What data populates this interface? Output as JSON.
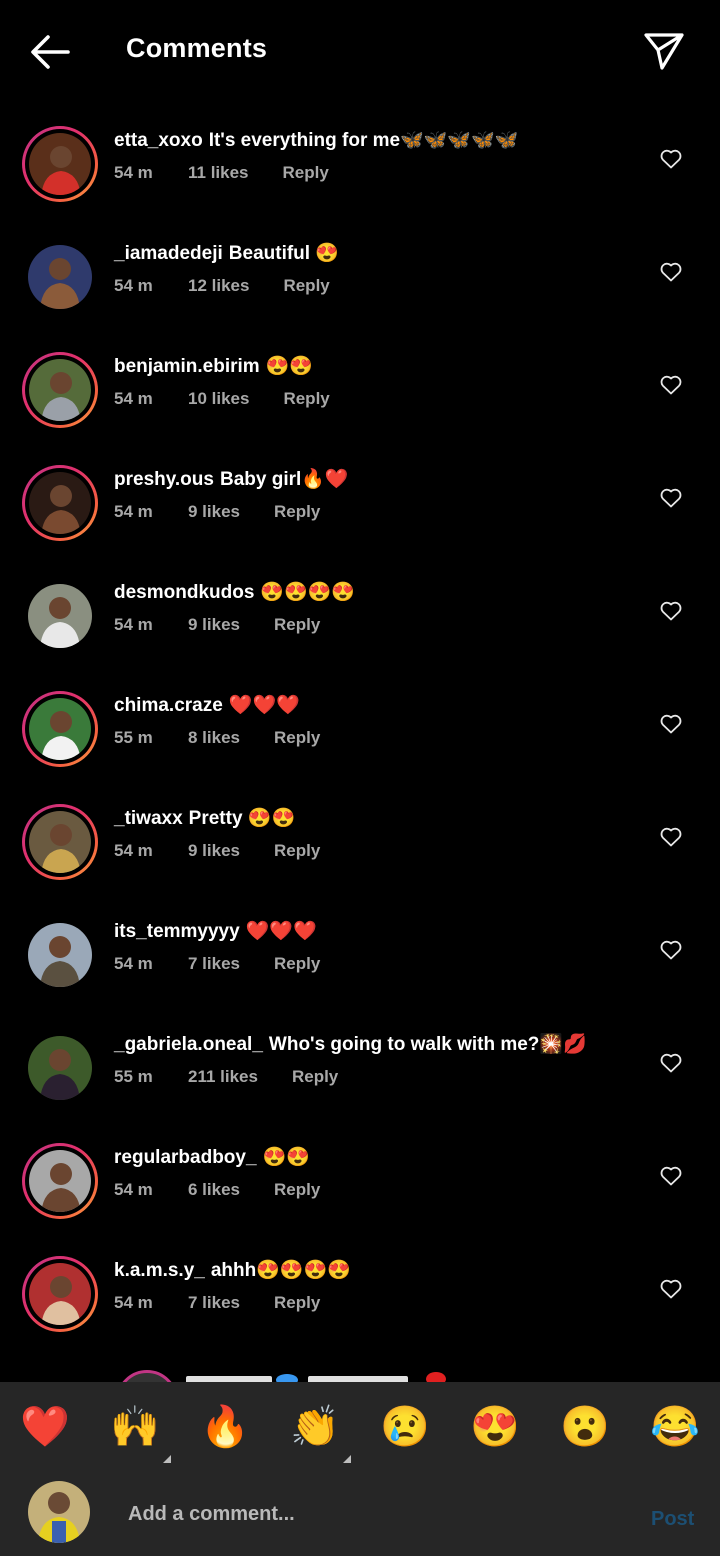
{
  "header": {
    "title": "Comments",
    "back_icon": "arrow-left-icon",
    "send_icon": "send-icon"
  },
  "comments": [
    {
      "username": "etta_xoxo",
      "text": "It's everything for me🦋🦋🦋🦋🦋",
      "time": "54 m",
      "likes": "11 likes",
      "reply": "Reply",
      "story_ring": true,
      "avatar_bg": "#5a2f1a",
      "avatar_fg": "#d3302a"
    },
    {
      "username": "_iamadedeji",
      "text": "Beautiful 😍",
      "time": "54 m",
      "likes": "12 likes",
      "reply": "Reply",
      "story_ring": false,
      "avatar_bg": "#2f3a6c",
      "avatar_fg": "#8b5b3a"
    },
    {
      "username": "benjamin.ebirim",
      "text": "😍😍",
      "time": "54 m",
      "likes": "10 likes",
      "reply": "Reply",
      "story_ring": true,
      "avatar_bg": "#556b3a",
      "avatar_fg": "#9aa0a8"
    },
    {
      "username": "preshy.ous",
      "text": "Baby girl🔥❤️",
      "time": "54 m",
      "likes": "9 likes",
      "reply": "Reply",
      "story_ring": true,
      "avatar_bg": "#2a1a14",
      "avatar_fg": "#7a4a30"
    },
    {
      "username": "desmondkudos",
      "text": "😍😍😍😍",
      "time": "54 m",
      "likes": "9 likes",
      "reply": "Reply",
      "story_ring": false,
      "avatar_bg": "#8a8f80",
      "avatar_fg": "#e8e8e8"
    },
    {
      "username": "chima.craze",
      "text": "❤️❤️❤️",
      "time": "55 m",
      "likes": "8 likes",
      "reply": "Reply",
      "story_ring": true,
      "avatar_bg": "#3a7a3a",
      "avatar_fg": "#f2f2f2"
    },
    {
      "username": "_tiwaxx",
      "text": "Pretty 😍😍",
      "time": "54 m",
      "likes": "9 likes",
      "reply": "Reply",
      "story_ring": true,
      "avatar_bg": "#6a5a40",
      "avatar_fg": "#c9a550"
    },
    {
      "username": "its_temmyyyy",
      "text": "❤️❤️❤️",
      "time": "54 m",
      "likes": "7 likes",
      "reply": "Reply",
      "story_ring": false,
      "avatar_bg": "#9aa8b8",
      "avatar_fg": "#5a5040"
    },
    {
      "username": "_gabriela.oneal_",
      "text": "Who's going to walk with me?🎇💋",
      "time": "55 m",
      "likes": "211 likes",
      "reply": "Reply",
      "story_ring": false,
      "avatar_bg": "#3d5a2a",
      "avatar_fg": "#2a2030"
    },
    {
      "username": "regularbadboy_",
      "text": "😍😍",
      "time": "54 m",
      "likes": "6 likes",
      "reply": "Reply",
      "story_ring": true,
      "avatar_bg": "#a8a8a8",
      "avatar_fg": "#6a4530"
    },
    {
      "username": "k.a.m.s.y_",
      "text": "ahhh😍😍😍😍",
      "time": "54 m",
      "likes": "7 likes",
      "reply": "Reply",
      "story_ring": true,
      "avatar_bg": "#b03030",
      "avatar_fg": "#e0c0a0"
    }
  ],
  "reactions": [
    "❤️",
    "🙌",
    "🔥",
    "👏",
    "😢",
    "😍",
    "😮",
    "😂"
  ],
  "composer": {
    "placeholder": "Add a comment...",
    "post_label": "Post"
  },
  "colors": {
    "background": "#000000",
    "panel": "#262626",
    "meta_text": "#a8a8a8",
    "post_disabled": "#1c4f73"
  }
}
